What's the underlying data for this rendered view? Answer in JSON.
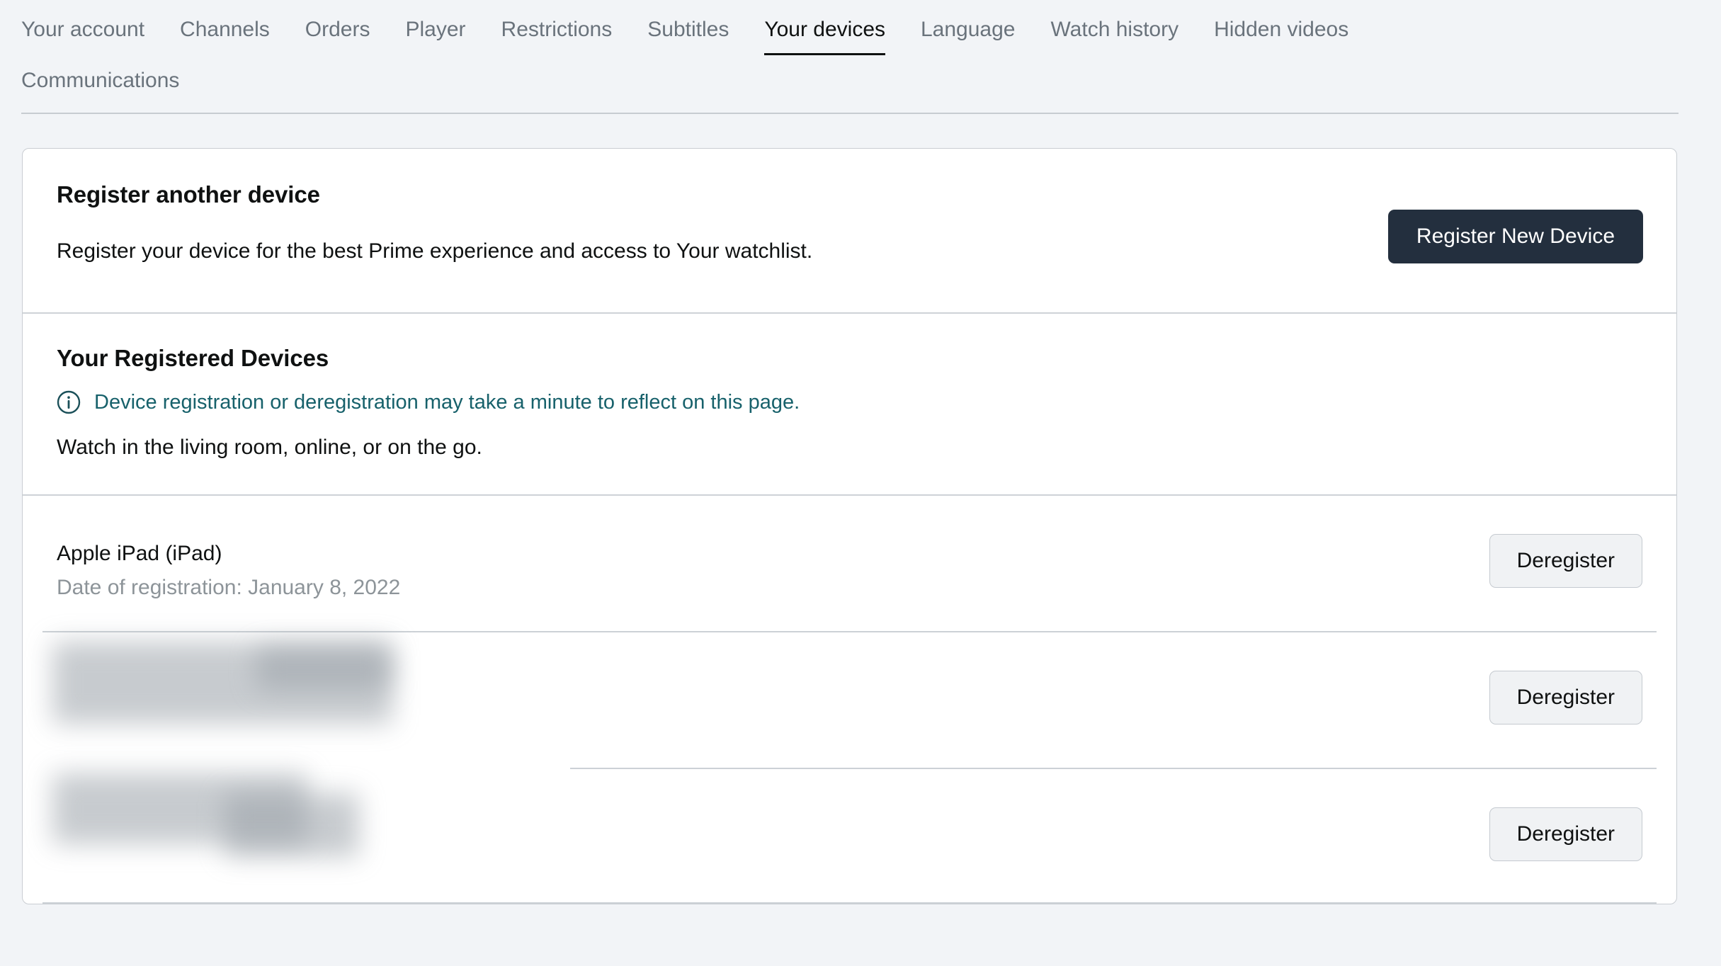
{
  "nav": {
    "items": [
      {
        "label": "Your account",
        "active": false,
        "row": 1
      },
      {
        "label": "Channels",
        "active": false,
        "row": 1
      },
      {
        "label": "Orders",
        "active": false,
        "row": 1
      },
      {
        "label": "Player",
        "active": false,
        "row": 1
      },
      {
        "label": "Restrictions",
        "active": false,
        "row": 1
      },
      {
        "label": "Subtitles",
        "active": false,
        "row": 1
      },
      {
        "label": "Your devices",
        "active": true,
        "row": 1
      },
      {
        "label": "Language",
        "active": false,
        "row": 1
      },
      {
        "label": "Watch history",
        "active": false,
        "row": 1
      },
      {
        "label": "Hidden videos",
        "active": false,
        "row": 1
      },
      {
        "label": "Communications",
        "active": false,
        "row": 2
      }
    ]
  },
  "register_section": {
    "title": "Register another device",
    "description": "Register your device for the best Prime experience and access to Your watchlist.",
    "button_label": "Register New Device"
  },
  "devices_section": {
    "title": "Your Registered Devices",
    "info_icon": "info-circle-icon",
    "info_text": "Device registration or deregistration may take a minute to reflect on this page.",
    "subtitle": "Watch in the living room, online, or on the go."
  },
  "devices": [
    {
      "name": "Apple iPad (iPad)",
      "registration": "Date of registration: January 8, 2022",
      "button_label": "Deregister",
      "masked": false
    },
    {
      "name": "",
      "registration": "",
      "button_label": "Deregister",
      "masked": true
    },
    {
      "name": "",
      "registration": "",
      "button_label": "Deregister",
      "masked": true
    }
  ],
  "colors": {
    "page_background": "#f2f4f7",
    "card_background": "#ffffff",
    "card_border": "#c9cdd2",
    "primary_button_background": "#232f3e",
    "primary_button_text": "#ffffff",
    "secondary_button_background": "#f0f2f4",
    "secondary_button_border": "#c5cad0",
    "nav_inactive_text": "#6a737c",
    "nav_active_text": "#0f1111",
    "info_text": "#17616b",
    "muted_text": "#8d9499",
    "divider": "#ccd1d6"
  }
}
